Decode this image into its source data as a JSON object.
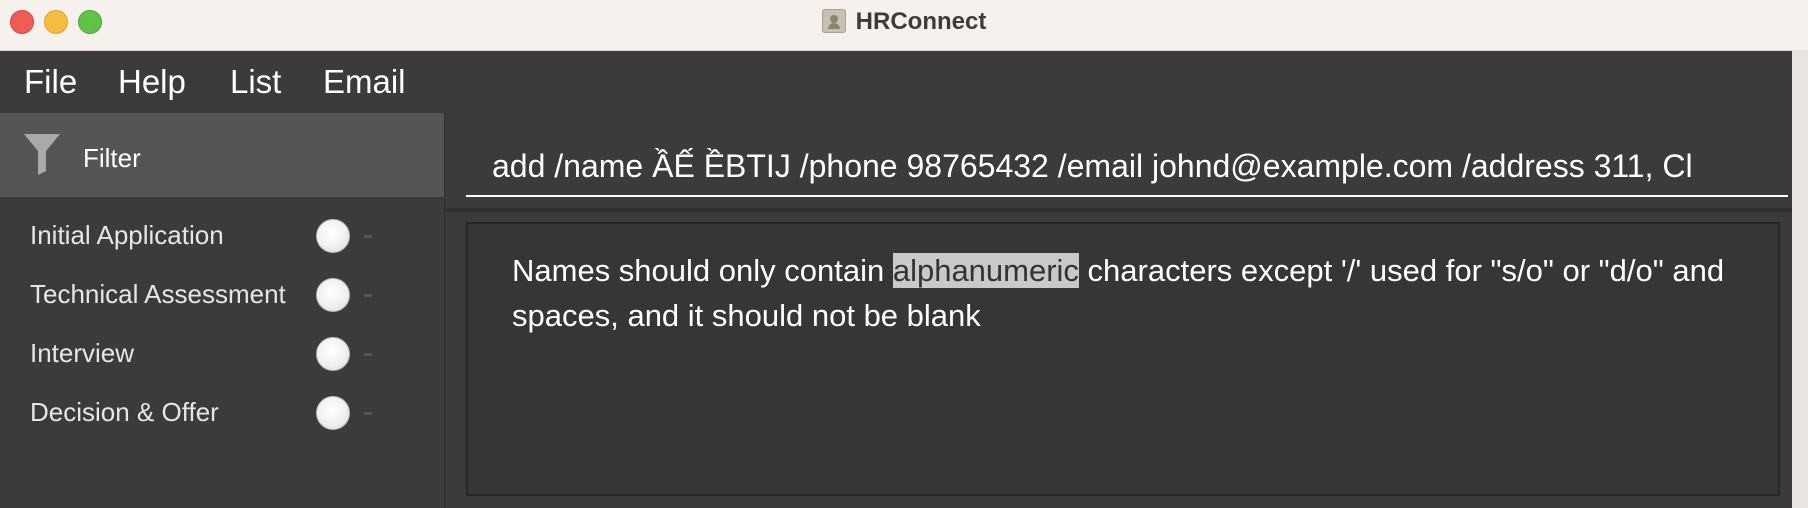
{
  "window": {
    "title": "HRConnect",
    "colors": {
      "background": "#3b3b3b",
      "titlebar": "#f7f1ee",
      "close": "#ee5c55",
      "minimize": "#f4bd3f",
      "maximize": "#5ec347",
      "filter_header": "#555555",
      "highlight": "#c9c9c9"
    }
  },
  "menu": {
    "items": [
      "File",
      "Help",
      "List",
      "Email"
    ]
  },
  "sidebar": {
    "filter_icon": "funnel-icon",
    "filter_label": "Filter",
    "stages": [
      {
        "label": "Initial Application",
        "selected": false
      },
      {
        "label": "Technical Assessment",
        "selected": false
      },
      {
        "label": "Interview",
        "selected": false
      },
      {
        "label": "Decision & Offer",
        "selected": false
      }
    ]
  },
  "command": {
    "value": "add /name ẦẾ ỀBTIJ /phone 98765432 /email johnd@example.com /address 311, Cl"
  },
  "result": {
    "before": "Names should only contain ",
    "highlight": "alphanumeric",
    "after": " characters except '/' used for \"s/o\" or \"d/o\" and spaces, and it should not be blank"
  }
}
